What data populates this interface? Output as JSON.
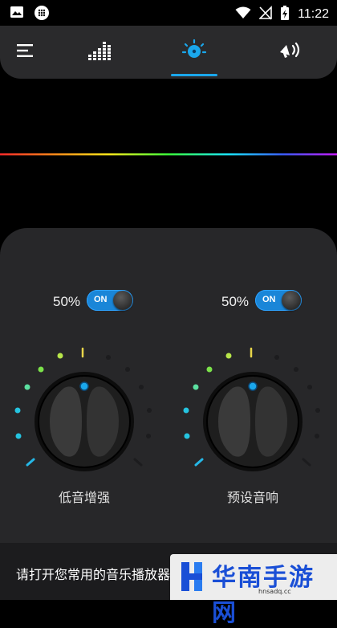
{
  "status_bar": {
    "time": "11:22",
    "left_icons": [
      "image-icon",
      "app-grid-icon"
    ],
    "right_icons": [
      "wifi-icon",
      "no-signal-icon",
      "battery-charging-icon"
    ]
  },
  "tabs": [
    {
      "name": "menu-icon",
      "selected": false
    },
    {
      "name": "equalizer-icon",
      "selected": false
    },
    {
      "name": "bass-boost-icon",
      "selected": true
    },
    {
      "name": "volume-icon",
      "selected": false
    }
  ],
  "colors": {
    "accent": "#1aa7ec",
    "panel": "#272729",
    "header": "#2a2a2c",
    "knob_dot_teal": "#25c4e0",
    "knob_dot_green": "#7be24a",
    "knob_dot_yellow": "#e8d64a"
  },
  "controls": {
    "left": {
      "percent": "50%",
      "toggle_label": "ON",
      "label": "低音增强",
      "level": 0.5
    },
    "right": {
      "percent": "50%",
      "toggle_label": "ON",
      "label": "预设音响",
      "level": 0.5
    }
  },
  "banner": {
    "text": "请打开您常用的音乐播放器"
  },
  "watermark": {
    "title": "华南手游网",
    "url": "hnsadq.cc"
  }
}
